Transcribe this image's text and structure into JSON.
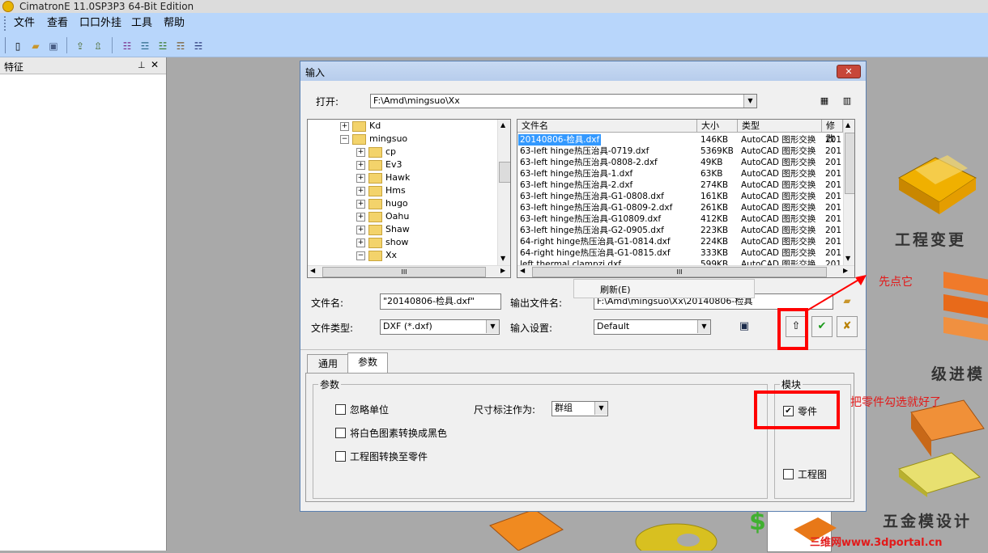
{
  "app": {
    "title": "CimatronE 11.0SP3P3 64-Bit Edition"
  },
  "menubar": {
    "items": [
      "文件",
      "查看",
      "口口外挂",
      "工具",
      "帮助"
    ]
  },
  "toolbar": {
    "icons": [
      "new-file-icon",
      "open-folder-icon",
      "save-icon",
      "import-icon",
      "export-icon",
      "tool-a-icon",
      "tool-b-icon",
      "tool-c-icon",
      "tool-d-icon",
      "tool-e-icon"
    ]
  },
  "left_panel": {
    "title": "特征",
    "pin": "ᵖ",
    "close": "✕"
  },
  "background": {
    "labels": [
      "工程变更",
      "级进模",
      "五金模设计"
    ],
    "watermark": "三维网www.3dportal.cn"
  },
  "annotations": {
    "first": "先点它",
    "second": "把零件勾选就好了"
  },
  "dialog": {
    "title": "输入",
    "close": "✕",
    "open_label": "打开:",
    "open_path": "F:\\Amd\\mingsuo\\Xx",
    "tree": [
      {
        "label": "Kd",
        "expander": "+",
        "level": 0
      },
      {
        "label": "mingsuo",
        "expander": "−",
        "level": 0
      },
      {
        "label": "cp",
        "expander": "+",
        "level": 1
      },
      {
        "label": "Ev3",
        "expander": "+",
        "level": 1
      },
      {
        "label": "Hawk",
        "expander": "+",
        "level": 1
      },
      {
        "label": "Hms",
        "expander": "+",
        "level": 1
      },
      {
        "label": "hugo",
        "expander": "+",
        "level": 1
      },
      {
        "label": "Oahu",
        "expander": "+",
        "level": 1
      },
      {
        "label": "Shaw",
        "expander": "+",
        "level": 1
      },
      {
        "label": "show",
        "expander": "+",
        "level": 1
      },
      {
        "label": "Xx",
        "expander": "−",
        "level": 1
      }
    ],
    "file_columns": [
      "文件名",
      "大小",
      "类型",
      "修改"
    ],
    "files": [
      {
        "name": "20140806-检具.dxf",
        "size": "146KB",
        "type": "AutoCAD 图形交换",
        "date": "201",
        "selected": true
      },
      {
        "name": "63-left hinge热压治具-0719.dxf",
        "size": "5369KB",
        "type": "AutoCAD 图形交换",
        "date": "201"
      },
      {
        "name": "63-left hinge热压治具-0808-2.dxf",
        "size": "49KB",
        "type": "AutoCAD 图形交换",
        "date": "201"
      },
      {
        "name": "63-left hinge热压治具-1.dxf",
        "size": "63KB",
        "type": "AutoCAD 图形交换",
        "date": "201"
      },
      {
        "name": "63-left hinge热压治具-2.dxf",
        "size": "274KB",
        "type": "AutoCAD 图形交换",
        "date": "201"
      },
      {
        "name": "63-left hinge热压治具-G1-0808.dxf",
        "size": "161KB",
        "type": "AutoCAD 图形交换",
        "date": "201"
      },
      {
        "name": "63-left hinge热压治具-G1-0809-2.dxf",
        "size": "261KB",
        "type": "AutoCAD 图形交换",
        "date": "201"
      },
      {
        "name": "63-left hinge热压治具-G10809.dxf",
        "size": "412KB",
        "type": "AutoCAD 图形交换",
        "date": "201"
      },
      {
        "name": "63-left hinge热压治具-G2-0905.dxf",
        "size": "223KB",
        "type": "AutoCAD 图形交换",
        "date": "201"
      },
      {
        "name": "64-right hinge热压治具-G1-0814.dxf",
        "size": "224KB",
        "type": "AutoCAD 图形交换",
        "date": "201"
      },
      {
        "name": "64-right hinge热压治具-G1-0815.dxf",
        "size": "333KB",
        "type": "AutoCAD 图形交换",
        "date": "201"
      },
      {
        "name": "left thermal clampzj.dxf",
        "size": "599KB",
        "type": "AutoCAD 图形交换",
        "date": "201"
      }
    ],
    "context_menu": {
      "refresh": "刷新(E)"
    },
    "filename_label": "文件名:",
    "filename_value": "\"20140806-检具.dxf\"",
    "output_label": "输出文件名:",
    "output_value": "F:\\Amd\\mingsuo\\Xx\\20140806-检具",
    "filetype_label": "文件类型:",
    "filetype_value": "DXF (*.dxf)",
    "settings_label": "输入设置:",
    "settings_value": "Default",
    "tabs": [
      "通用",
      "参数"
    ],
    "params": {
      "group_label": "参数",
      "ignore_units": "忽略单位",
      "dim_as_label": "尺寸标注作为:",
      "dim_as_value": "群组",
      "white_to_black": "将白色图素转换成黑色",
      "drawing_to_part": "工程图转换至零件"
    },
    "module": {
      "group_label": "模块",
      "part": "零件",
      "part_checked": "✔",
      "drawing": "工程图"
    }
  }
}
